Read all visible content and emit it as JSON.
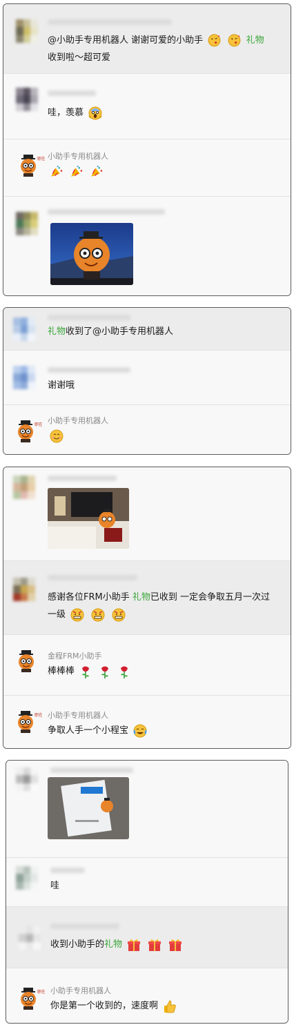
{
  "cards": [
    {
      "messages": [
        {
          "sender": "",
          "text_parts": [
            "@小助手专用机器人 谢谢可爱的小助手",
            "",
            "礼物",
            "收到啦～超可爱"
          ]
        },
        {
          "sender": "",
          "text": "哇，羡慕"
        },
        {
          "sender": "小助手专用机器人",
          "text": ""
        },
        {
          "sender": "",
          "text": ""
        }
      ]
    },
    {
      "messages": [
        {
          "sender": "",
          "text_parts": [
            "礼物",
            "收到了@小助手专用机器人"
          ]
        },
        {
          "sender": "",
          "text": "谢谢哦"
        },
        {
          "sender": "小助手专用机器人",
          "text": ""
        }
      ]
    },
    {
      "messages": [
        {
          "sender": "",
          "text": ""
        },
        {
          "sender": "",
          "text_parts": [
            "感谢各位FRM小助手 ",
            "礼物",
            "已收到 一定会争取五月一次过一级"
          ]
        },
        {
          "sender": "金程FRM小助手",
          "text": "棒棒棒"
        },
        {
          "sender": "小助手专用机器人",
          "text": "争取人手一个小程宝"
        }
      ]
    },
    {
      "messages": [
        {
          "sender": "",
          "text": ""
        },
        {
          "sender": "",
          "text": "哇"
        },
        {
          "sender": "",
          "text_parts": [
            "收到小助手的",
            "礼物"
          ]
        },
        {
          "sender": "小助手专用机器人",
          "text": "你是第一个收到的，速度啊"
        }
      ]
    }
  ],
  "robot_badge": "职在有途",
  "emoji_names": [
    "kiss-emoji",
    "party-popper-emoji",
    "scream-emoji",
    "smile-emoji",
    "grin-emoji",
    "rose-emoji",
    "laugh-cry-emoji",
    "gift-emoji",
    "thumbs-up-emoji"
  ],
  "colors": {
    "gift_text": "#3aa63a",
    "card_border": "#5a5a5a",
    "highlight_row": "#ececec",
    "mascot_orange": "#e8842a"
  }
}
